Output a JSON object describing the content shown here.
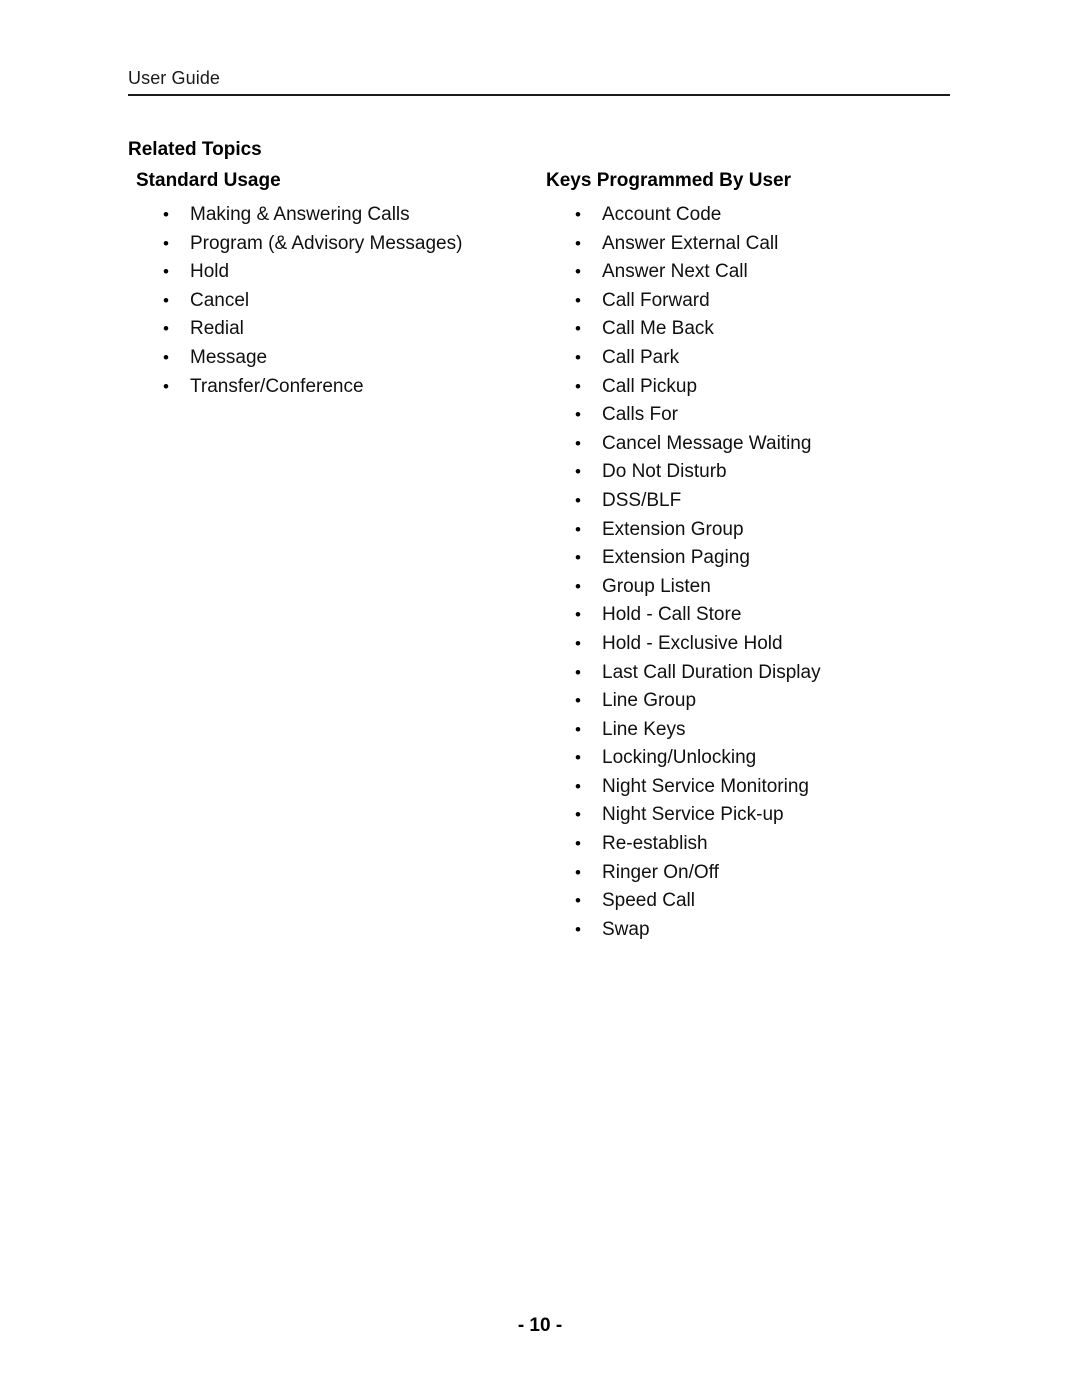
{
  "document": {
    "header_text": "User Guide",
    "section_title": "Related Topics",
    "footer_page_number": "- 10 -",
    "bullet_glyph": "•",
    "text_color": "#000000",
    "background_color": "#ffffff",
    "rule_color": "#1a1a1a"
  },
  "columns": {
    "left": {
      "heading": "Standard Usage",
      "items": [
        "Making & Answering Calls",
        "Program (& Advisory Messages)",
        "Hold",
        "Cancel",
        "Redial",
        "Message",
        "Transfer/Conference"
      ]
    },
    "right": {
      "heading": "Keys Programmed By User",
      "items": [
        "Account Code",
        "Answer External Call",
        "Answer Next Call",
        "Call Forward",
        "Call Me Back",
        "Call Park",
        "Call Pickup",
        "Calls For",
        "Cancel Message Waiting",
        "Do Not Disturb",
        "DSS/BLF",
        "Extension Group",
        "Extension Paging",
        "Group Listen",
        "Hold - Call Store",
        "Hold - Exclusive Hold",
        "Last Call Duration Display",
        "Line Group",
        "Line Keys",
        "Locking/Unlocking",
        "Night Service Monitoring",
        "Night Service Pick-up",
        "Re-establish",
        "Ringer On/Off",
        "Speed Call",
        "Swap"
      ]
    }
  }
}
